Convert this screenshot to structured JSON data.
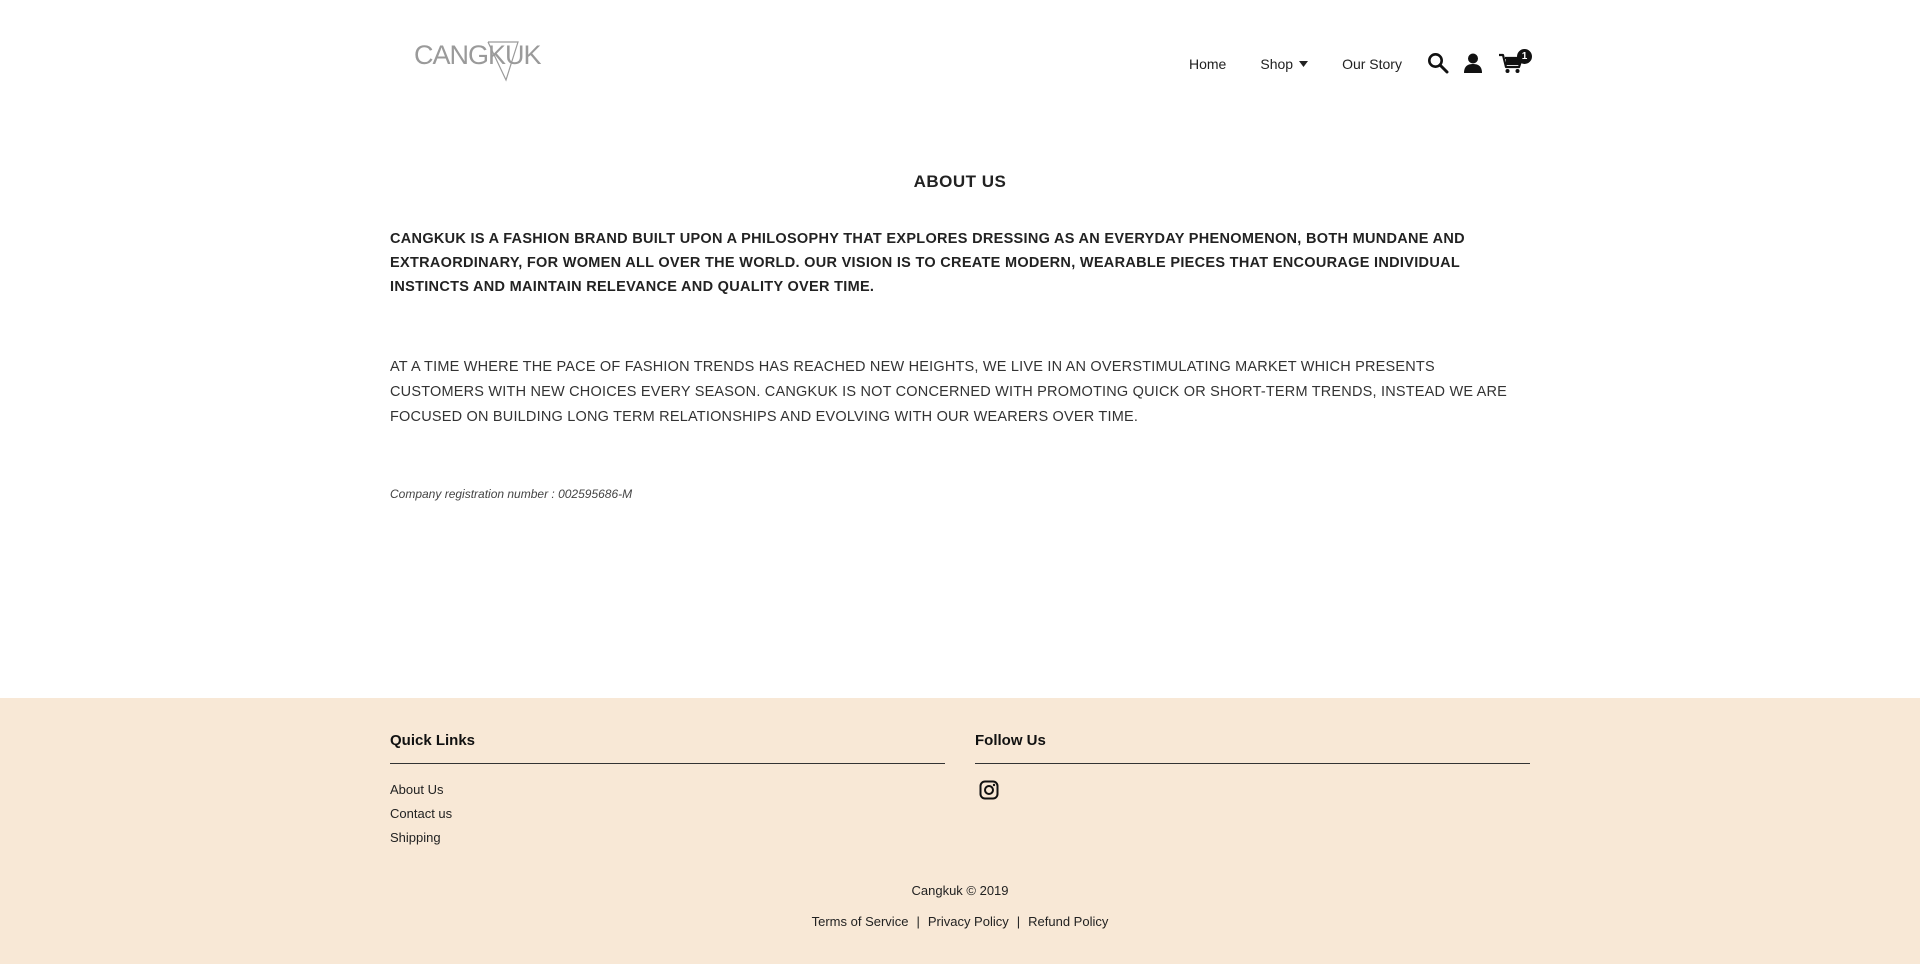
{
  "brand": {
    "logo_text": "CANGKUK"
  },
  "nav": {
    "home": "Home",
    "shop": "Shop",
    "story": "Our Story"
  },
  "cart": {
    "count": "1"
  },
  "icons": {
    "search": "search-icon",
    "account": "user-icon",
    "cart": "cart-icon",
    "caret": "caret-down-icon",
    "instagram": "instagram-icon"
  },
  "main": {
    "title": "ABOUT US",
    "intro": "CANGKUK IS A FASHION BRAND BUILT UPON A PHILOSOPHY THAT EXPLORES DRESSING AS AN EVERYDAY PHENOMENON, BOTH MUNDANE AND EXTRAORDINARY, FOR WOMEN ALL OVER THE WORLD. OUR VISION IS TO CREATE MODERN, WEARABLE PIECES THAT ENCOURAGE INDIVIDUAL INSTINCTS AND MAINTAIN RELEVANCE AND QUALITY OVER TIME.",
    "body": "AT A TIME WHERE THE PACE OF FASHION TRENDS HAS REACHED NEW HEIGHTS, WE LIVE IN AN OVERSTIMULATING MARKET WHICH PRESENTS CUSTOMERS WITH NEW CHOICES EVERY SEASON. CANGKUK IS NOT CONCERNED WITH PROMOTING QUICK OR SHORT-TERM TRENDS, INSTEAD WE ARE FOCUSED ON BUILDING LONG TERM RELATIONSHIPS AND EVOLVING WITH OUR WEARERS OVER TIME.",
    "registration": "Company registration number : 002595686-M"
  },
  "footer": {
    "quick_links_heading": "Quick Links",
    "quick_links": [
      "About Us",
      "Contact us",
      "Shipping"
    ],
    "follow_heading": "Follow Us",
    "copyright": "Cangkuk © 2019",
    "policies": [
      "Terms of Service",
      "Privacy Policy",
      "Refund Policy"
    ],
    "separator": "|"
  },
  "colors": {
    "footer_bg": "#f8e8d6",
    "text": "#222222",
    "logo": "#9a9a9a"
  }
}
